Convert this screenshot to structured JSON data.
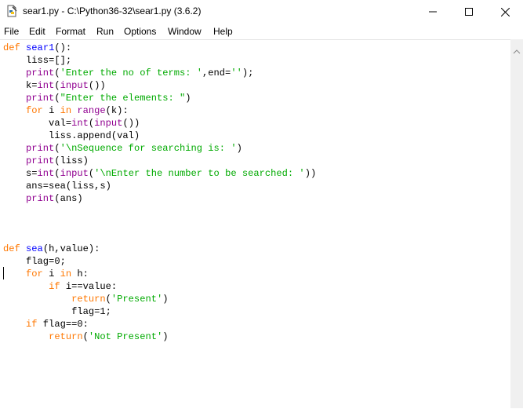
{
  "window": {
    "title": "sear1.py - C:\\Python36-32\\sear1.py (3.6.2)"
  },
  "menu": [
    "File",
    "Edit",
    "Format",
    "Run",
    "Options",
    "Window",
    "Help"
  ],
  "colors": {
    "keyword": "#ff7700",
    "definition": "#0000ff",
    "builtin": "#900090",
    "string": "#00aa00",
    "default": "#000000"
  },
  "code_lines": [
    [
      [
        "def",
        "kw"
      ],
      [
        " ",
        ""
      ],
      [
        "sear1",
        "fn"
      ],
      [
        "():",
        ""
      ]
    ],
    [
      [
        "    liss=[];",
        ""
      ]
    ],
    [
      [
        "    ",
        ""
      ],
      [
        "print",
        "bi"
      ],
      [
        "(",
        ""
      ],
      [
        "'Enter the no of terms: '",
        "st"
      ],
      [
        ",end=",
        ""
      ],
      [
        "''",
        "st"
      ],
      [
        ");",
        ""
      ]
    ],
    [
      [
        "    k=",
        ""
      ],
      [
        "int",
        "bi"
      ],
      [
        "(",
        ""
      ],
      [
        "input",
        "bi"
      ],
      [
        "())",
        ""
      ]
    ],
    [
      [
        "    ",
        ""
      ],
      [
        "print",
        "bi"
      ],
      [
        "(",
        ""
      ],
      [
        "\"Enter the elements: \"",
        "st"
      ],
      [
        ")",
        ""
      ]
    ],
    [
      [
        "    ",
        ""
      ],
      [
        "for",
        "kw"
      ],
      [
        " i ",
        ""
      ],
      [
        "in",
        "kw"
      ],
      [
        " ",
        ""
      ],
      [
        "range",
        "bi"
      ],
      [
        "(k):",
        ""
      ]
    ],
    [
      [
        "        val=",
        ""
      ],
      [
        "int",
        "bi"
      ],
      [
        "(",
        ""
      ],
      [
        "input",
        "bi"
      ],
      [
        "())",
        ""
      ]
    ],
    [
      [
        "        liss.append(val)",
        ""
      ]
    ],
    [
      [
        "    ",
        ""
      ],
      [
        "print",
        "bi"
      ],
      [
        "(",
        ""
      ],
      [
        "'\\nSequence for searching is: '",
        "st"
      ],
      [
        ")",
        ""
      ]
    ],
    [
      [
        "    ",
        ""
      ],
      [
        "print",
        "bi"
      ],
      [
        "(liss)",
        ""
      ]
    ],
    [
      [
        "    s=",
        ""
      ],
      [
        "int",
        "bi"
      ],
      [
        "(",
        ""
      ],
      [
        "input",
        "bi"
      ],
      [
        "(",
        ""
      ],
      [
        "'\\nEnter the number to be searched: '",
        "st"
      ],
      [
        "))",
        ""
      ]
    ],
    [
      [
        "    ans=sea(liss,s)",
        ""
      ]
    ],
    [
      [
        "    ",
        ""
      ],
      [
        "print",
        "bi"
      ],
      [
        "(ans)",
        ""
      ]
    ],
    [
      [
        "",
        ""
      ]
    ],
    [
      [
        "",
        ""
      ]
    ],
    [
      [
        "",
        ""
      ]
    ],
    [
      [
        "def",
        "kw"
      ],
      [
        " ",
        ""
      ],
      [
        "sea",
        "fn"
      ],
      [
        "(h,value):",
        ""
      ]
    ],
    [
      [
        "    flag=0;",
        ""
      ]
    ],
    [
      [
        "    ",
        ""
      ],
      [
        "for",
        "kw"
      ],
      [
        " i ",
        ""
      ],
      [
        "in",
        "kw"
      ],
      [
        " h:",
        ""
      ]
    ],
    [
      [
        "        ",
        ""
      ],
      [
        "if",
        "kw"
      ],
      [
        " i==value:",
        ""
      ]
    ],
    [
      [
        "            ",
        ""
      ],
      [
        "return",
        "kw"
      ],
      [
        "(",
        ""
      ],
      [
        "'Present'",
        "st"
      ],
      [
        ")",
        ""
      ]
    ],
    [
      [
        "            flag=1;",
        ""
      ]
    ],
    [
      [
        "    ",
        ""
      ],
      [
        "if",
        "kw"
      ],
      [
        " flag==0:",
        ""
      ]
    ],
    [
      [
        "        ",
        ""
      ],
      [
        "return",
        "kw"
      ],
      [
        "(",
        ""
      ],
      [
        "'Not Present'",
        "st"
      ],
      [
        ")",
        ""
      ]
    ]
  ]
}
